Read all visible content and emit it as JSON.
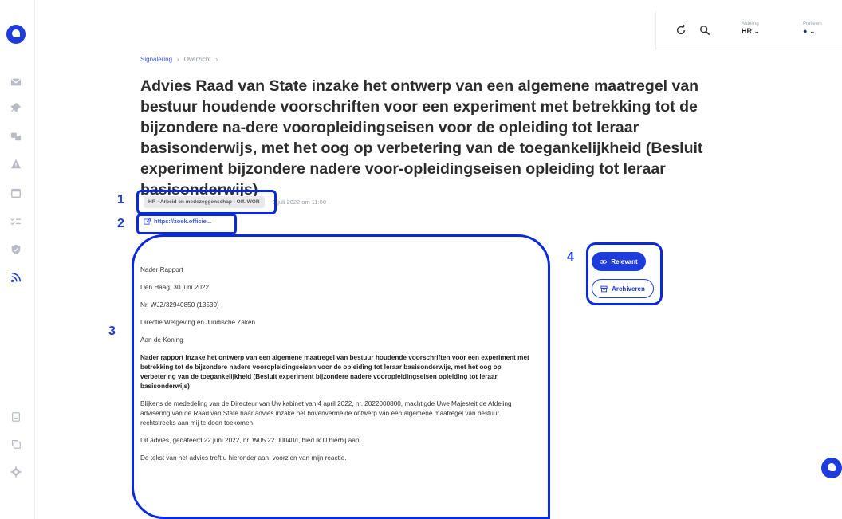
{
  "breadcrumb": {
    "items": [
      "Signalering",
      "Overzicht"
    ],
    "separator": "›"
  },
  "topbar": {
    "department_label": "Afdeling",
    "department_value": "HR",
    "profile_label": "Profielen"
  },
  "document": {
    "title": "Advies Raad van State inzake het ontwerp van een algemene maatregel van bestuur houdende voorschriften voor een experiment met betrekking tot de bijzondere na-dere vooropleidingseisen voor de opleiding tot leraar basisonderwijs, met het oog op verbetering van de toegankelijkheid (Besluit experiment bijzondere nadere voor-opleidingseisen opleiding tot leraar basisonderwijs)",
    "badge": "HR - Arbeid en medezeggenschap - Off. WOR",
    "date": "9 juli 2022 om 11:00",
    "source_link": "https://zoek.officie...",
    "body": [
      "Nader Rapport",
      "Den Haag, 30 juni 2022",
      "Nr. WJZ/32940850 (13530)",
      "Directie Wetgeving en Juridische Zaken",
      "Aan de Koning",
      "Nader rapport inzake het ontwerp van een algemene maatregel van bestuur houdende voorschriften voor een experiment met betrekking tot de bijzondere nadere vooropleidingseisen voor de opleiding tot leraar basisonderwijs, met het oog op verbetering van de toegankelijkheid (Besluit experiment bijzondere nadere vooropleidingseisen opleiding tot leraar basisonderwijs)",
      "Blijkens de mededeling van de Directeur van Uw kabinet van 4 april 2022, nr. 2022000800, machtigde Uwe Majesteit de Afdeling advisering van de Raad van State haar advies inzake het bovenvermelde ontwerp van een algemene maatregel van bestuur rechtstreeks aan mij te doen toekomen.",
      "Dit advies, gedateerd 22 juni 2022, nr. W05.22.00040/I, bied ik U hierbij aan.",
      "De tekst van het advies treft u hieronder aan, voorzien van mijn reactie."
    ]
  },
  "actions": {
    "relevant_label": "Relevant",
    "archive_label": "Archiveren"
  },
  "callouts": [
    "1",
    "2",
    "3",
    "4"
  ],
  "colors": {
    "accent": "#1e3bdc",
    "callout": "#0a28e0"
  }
}
